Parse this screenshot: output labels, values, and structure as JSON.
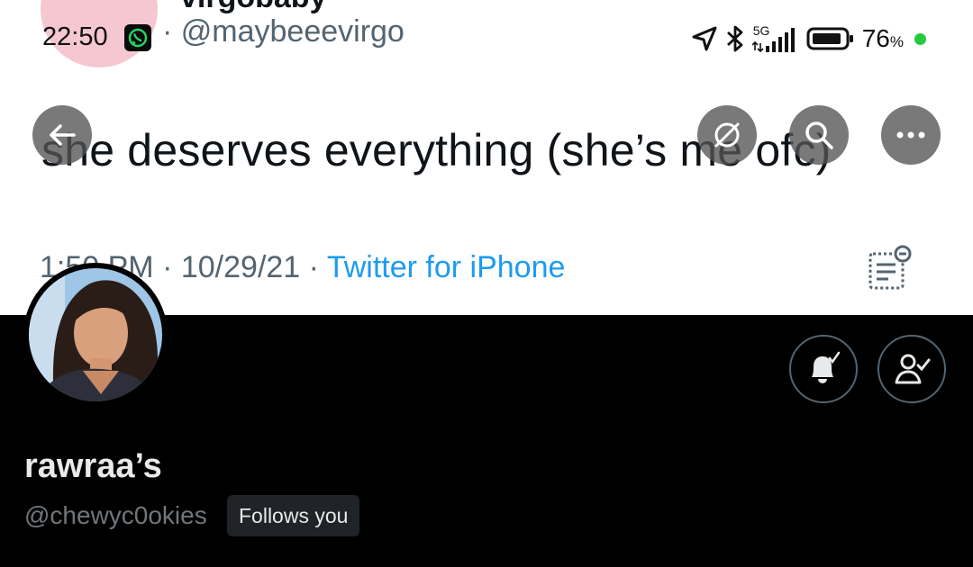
{
  "status_bar": {
    "time": "22:50",
    "network": "5G",
    "battery_percent": "76",
    "battery_unit": "%",
    "icons": [
      "whatsapp-icon",
      "location-arrow-icon",
      "bluetooth-icon",
      "signal-icon",
      "battery-icon"
    ]
  },
  "banner_tweet": {
    "handle": "· @maybeeevirgo",
    "text": "she deserves everything (she’s me ofc)",
    "time": "1:50 PM",
    "date": "10/29/21",
    "source": "Twitter for iPhone"
  },
  "toolbar": {
    "icons": [
      "back-arrow-icon",
      "stop-sharing-icon",
      "search-icon",
      "more-icon"
    ]
  },
  "profile": {
    "display_name": "rawraa’s",
    "handle": "@chewyc0okies",
    "follows_you_label": "Follows you",
    "buttons": [
      "notification-bell-icon",
      "following-person-icon"
    ]
  },
  "colors": {
    "banner_bg": "#ffffff",
    "page_bg": "#000000",
    "link_blue": "#1d9bf0",
    "secondary_text": "#71767b",
    "whatsapp_green": "#25d366",
    "online_green": "#27c93f"
  }
}
